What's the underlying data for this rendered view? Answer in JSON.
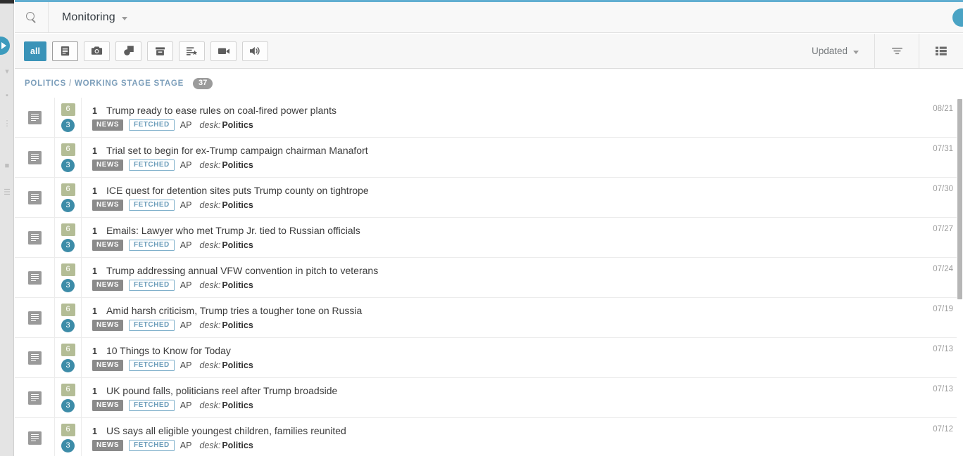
{
  "header": {
    "search_icon": "search-icon",
    "title": "Monitoring",
    "dropdown_icon": "chevron-down-icon"
  },
  "toolbar": {
    "filters": [
      {
        "label": "all",
        "icon": "all-text",
        "selected": true
      },
      {
        "label": "",
        "icon": "text-document-icon",
        "selected": false
      },
      {
        "label": "",
        "icon": "camera-icon",
        "selected": false
      },
      {
        "label": "",
        "icon": "graphic-shapes-icon",
        "selected": false
      },
      {
        "label": "",
        "icon": "archive-box-icon",
        "selected": false
      },
      {
        "label": "",
        "icon": "composite-star-icon",
        "selected": false
      },
      {
        "label": "",
        "icon": "video-camera-icon",
        "selected": false
      },
      {
        "label": "",
        "icon": "audio-speaker-icon",
        "selected": false
      }
    ],
    "sort_label": "Updated",
    "sort_caret_icon": "chevron-down-icon",
    "filter_icon": "filter-funnel-icon",
    "view_icon": "list-view-icon"
  },
  "breadcrumb": {
    "first": "POLITICS",
    "separator": "/",
    "second": "WORKING STAGE STAGE",
    "count": "37"
  },
  "colors": {
    "accent_teal": "#3a93b8",
    "top_accent": "#61aed1",
    "badge_square": "#b4bd96",
    "badge_circle": "#3d8ca8",
    "tag_news_bg": "#8a8a8a",
    "tag_fetched_border": "#7fb0cb",
    "crumb_link": "#7d9fbb"
  },
  "list": {
    "meta_labels": {
      "tag_news": "NEWS",
      "tag_fetched": "FETCHED",
      "source": "AP",
      "desk_label": "desk:",
      "desk_value": "Politics"
    },
    "items": [
      {
        "type_icon": "text-document-icon",
        "badge_square": "6",
        "badge_circle": "3",
        "version": "1",
        "headline": "Trump ready to ease rules on coal-fired power plants",
        "tag_news": "NEWS",
        "tag_fetched": "FETCHED",
        "source": "AP",
        "desk_label": "desk:",
        "desk_value": "Politics",
        "date": "08/21"
      },
      {
        "type_icon": "text-document-icon",
        "badge_square": "6",
        "badge_circle": "3",
        "version": "1",
        "headline": "Trial set to begin for ex-Trump campaign chairman Manafort",
        "tag_news": "NEWS",
        "tag_fetched": "FETCHED",
        "source": "AP",
        "desk_label": "desk:",
        "desk_value": "Politics",
        "date": "07/31"
      },
      {
        "type_icon": "text-document-icon",
        "badge_square": "6",
        "badge_circle": "3",
        "version": "1",
        "headline": "ICE quest for detention sites puts Trump county on tightrope",
        "tag_news": "NEWS",
        "tag_fetched": "FETCHED",
        "source": "AP",
        "desk_label": "desk:",
        "desk_value": "Politics",
        "date": "07/30"
      },
      {
        "type_icon": "text-document-icon",
        "badge_square": "6",
        "badge_circle": "3",
        "version": "1",
        "headline": "Emails: Lawyer who met Trump Jr. tied to Russian officials",
        "tag_news": "NEWS",
        "tag_fetched": "FETCHED",
        "source": "AP",
        "desk_label": "desk:",
        "desk_value": "Politics",
        "date": "07/27"
      },
      {
        "type_icon": "text-document-icon",
        "badge_square": "6",
        "badge_circle": "3",
        "version": "1",
        "headline": "Trump addressing annual VFW convention in pitch to veterans",
        "tag_news": "NEWS",
        "tag_fetched": "FETCHED",
        "source": "AP",
        "desk_label": "desk:",
        "desk_value": "Politics",
        "date": "07/24"
      },
      {
        "type_icon": "text-document-icon",
        "badge_square": "6",
        "badge_circle": "3",
        "version": "1",
        "headline": "Amid harsh criticism, Trump tries a tougher tone on Russia",
        "tag_news": "NEWS",
        "tag_fetched": "FETCHED",
        "source": "AP",
        "desk_label": "desk:",
        "desk_value": "Politics",
        "date": "07/19"
      },
      {
        "type_icon": "text-document-icon",
        "badge_square": "6",
        "badge_circle": "3",
        "version": "1",
        "headline": "10 Things to Know for Today",
        "tag_news": "NEWS",
        "tag_fetched": "FETCHED",
        "source": "AP",
        "desk_label": "desk:",
        "desk_value": "Politics",
        "date": "07/13"
      },
      {
        "type_icon": "text-document-icon",
        "badge_square": "6",
        "badge_circle": "3",
        "version": "1",
        "headline": "UK pound falls, politicians reel after Trump broadside",
        "tag_news": "NEWS",
        "tag_fetched": "FETCHED",
        "source": "AP",
        "desk_label": "desk:",
        "desk_value": "Politics",
        "date": "07/13"
      },
      {
        "type_icon": "text-document-icon",
        "badge_square": "6",
        "badge_circle": "3",
        "version": "1",
        "headline": "US says all eligible youngest children, families reunited",
        "tag_news": "NEWS",
        "tag_fetched": "FETCHED",
        "source": "AP",
        "desk_label": "desk:",
        "desk_value": "Politics",
        "date": "07/12"
      }
    ]
  },
  "sidebar": {
    "expand_icon": "expand-arrow-right-icon"
  }
}
